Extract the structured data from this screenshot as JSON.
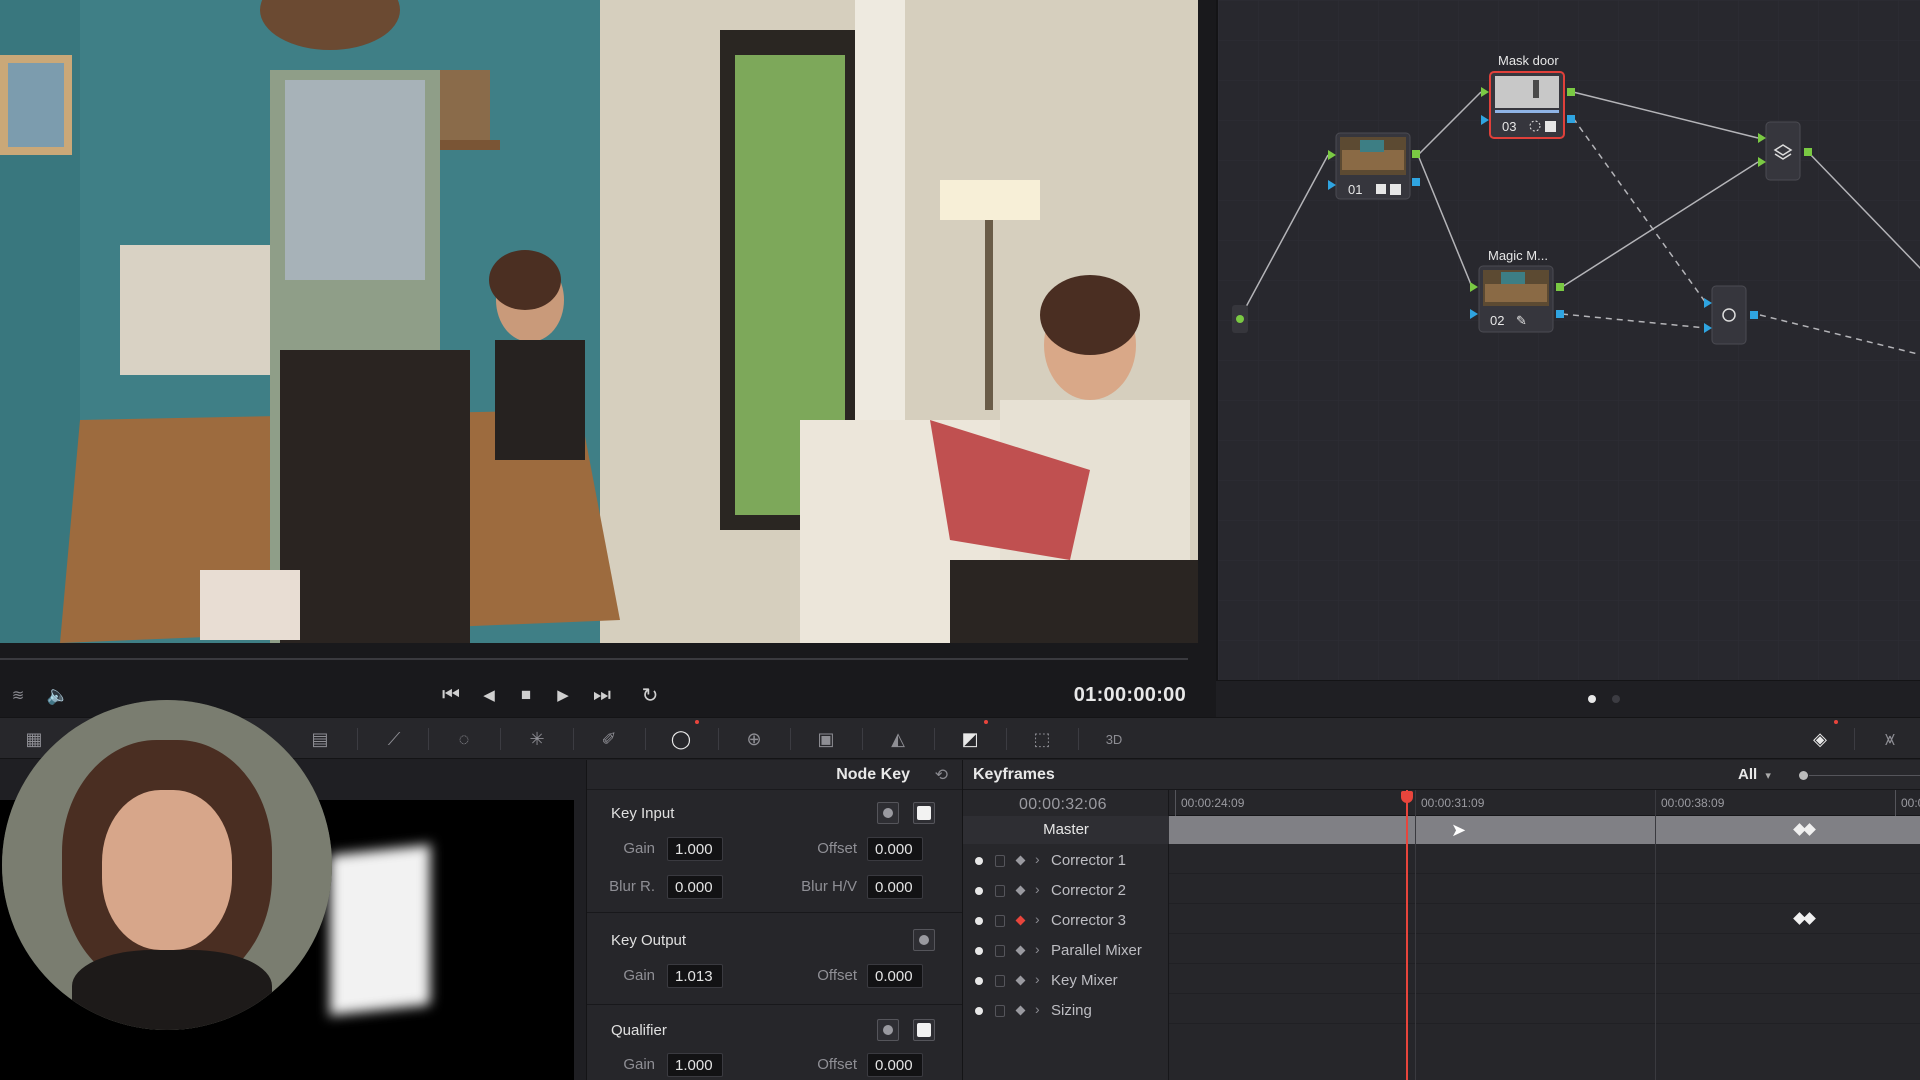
{
  "viewer": {
    "timecode": "01:00:00:00",
    "transport_icons": [
      "go-to-start-icon",
      "step-back-icon",
      "stop-icon",
      "play-icon",
      "go-to-end-icon",
      "loop-icon"
    ],
    "left_icons": [
      "layers-icon",
      "speaker-icon"
    ]
  },
  "node_graph": {
    "nodes": [
      {
        "id": "01",
        "label": "",
        "number": "01"
      },
      {
        "id": "02",
        "label": "Magic M...",
        "number": "02"
      },
      {
        "id": "03",
        "label": "Mask door",
        "number": "03"
      }
    ],
    "page_dots": 2,
    "active_page": 1
  },
  "toolbar": {
    "tools": [
      "lut-grid-icon",
      "color-wheels-icon",
      "primaries-icon",
      "curves-icon",
      "color-warper-icon",
      "qualifier-icon",
      "window-icon",
      "tracker-icon",
      "magic-mask-icon",
      "blur-icon",
      "key-icon",
      "sizing-icon",
      "3d-icon"
    ],
    "right_icons": [
      "keyframes-icon",
      "scopes-icon"
    ]
  },
  "node_key": {
    "title": "Node Key",
    "key_input": {
      "title": "Key Input",
      "gain_label": "Gain",
      "gain": "1.000",
      "offset_label": "Offset",
      "offset": "0.000",
      "blur_r_label": "Blur R.",
      "blur_r": "0.000",
      "blur_hv_label": "Blur H/V",
      "blur_hv": "0.000"
    },
    "key_output": {
      "title": "Key Output",
      "gain_label": "Gain",
      "gain": "1.013",
      "offset_label": "Offset",
      "offset": "0.000"
    },
    "qualifier": {
      "title": "Qualifier",
      "gain_label": "Gain",
      "gain": "1.000",
      "offset_label": "Offset",
      "offset": "0.000"
    }
  },
  "keyframes": {
    "title": "Keyframes",
    "filter": "All",
    "current_time": "00:00:32:06",
    "ruler": [
      "00:00:24:09",
      "00:00:31:09",
      "00:00:38:09",
      "00:0"
    ],
    "master_label": "Master",
    "tracks": [
      {
        "label": "Corrector 1",
        "keyframe_active": false
      },
      {
        "label": "Corrector 2",
        "keyframe_active": false
      },
      {
        "label": "Corrector 3",
        "keyframe_active": true
      },
      {
        "label": "Parallel Mixer",
        "keyframe_active": false
      },
      {
        "label": "Key Mixer",
        "keyframe_active": false
      },
      {
        "label": "Sizing",
        "keyframe_active": false
      }
    ]
  },
  "colors": {
    "accent_red": "#e8453c",
    "node_green": "#7ac943",
    "node_blue": "#2fa4e0",
    "selected_node_border": "#e0403a"
  }
}
